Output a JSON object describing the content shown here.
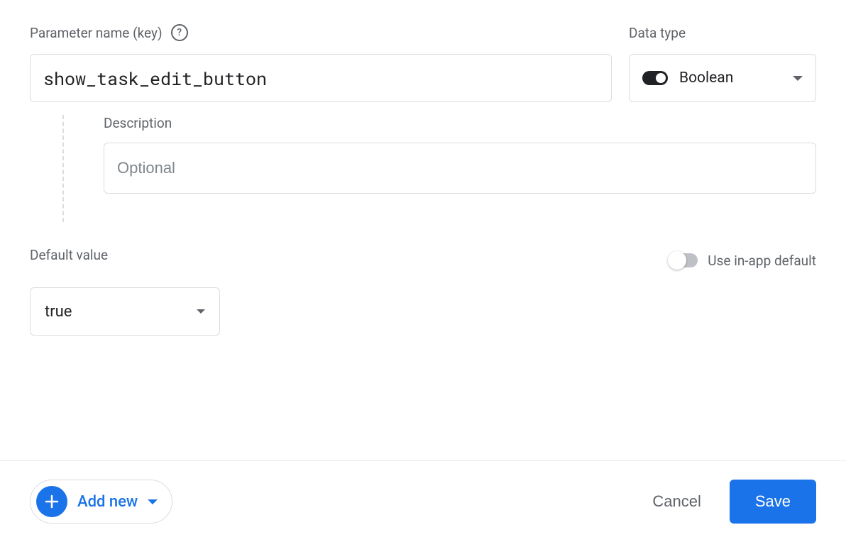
{
  "parameter": {
    "label": "Parameter name (key)",
    "value": "show_task_edit_button"
  },
  "datatype": {
    "label": "Data type",
    "selected": "Boolean"
  },
  "description": {
    "label": "Description",
    "placeholder": "Optional",
    "value": ""
  },
  "defaultValue": {
    "label": "Default value",
    "selected": "true"
  },
  "inAppDefault": {
    "label": "Use in-app default",
    "enabled": false
  },
  "footer": {
    "addNew": "Add new",
    "cancel": "Cancel",
    "save": "Save"
  }
}
